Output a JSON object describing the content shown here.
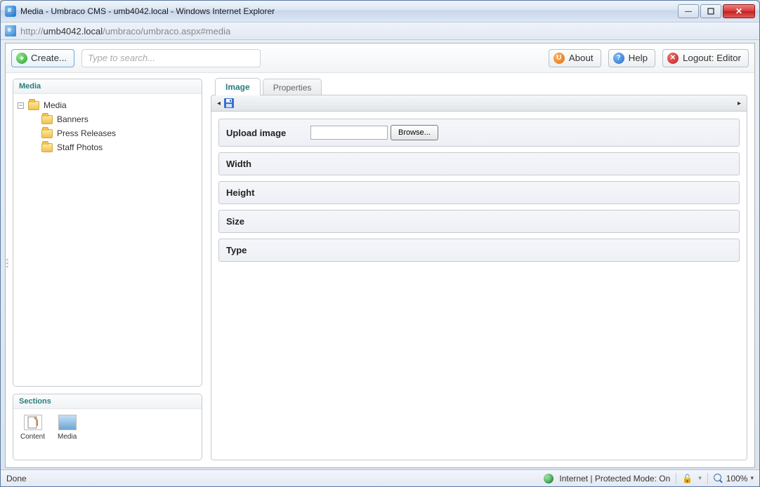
{
  "window": {
    "title": "Media - Umbraco CMS - umb4042.local - Windows Internet Explorer"
  },
  "address": {
    "scheme": "http://",
    "host": "umb4042.local",
    "path": "/umbraco/umbraco.aspx#media"
  },
  "toolbar": {
    "create_label": "Create...",
    "search_placeholder": "Type to search...",
    "about_label": "About",
    "help_label": "Help",
    "logout_label": "Logout: Editor"
  },
  "left": {
    "media_panel_title": "Media",
    "tree": {
      "root": "Media",
      "children": [
        "Banners",
        "Press Releases",
        "Staff Photos"
      ]
    },
    "sections_title": "Sections",
    "sections": {
      "content": "Content",
      "media": "Media"
    }
  },
  "editor": {
    "tabs": {
      "image": "Image",
      "properties": "Properties",
      "active": "image"
    },
    "fields": {
      "upload": {
        "label": "Upload image",
        "browse": "Browse..."
      },
      "width": {
        "label": "Width"
      },
      "height": {
        "label": "Height"
      },
      "size": {
        "label": "Size"
      },
      "type": {
        "label": "Type"
      }
    }
  },
  "status": {
    "done": "Done",
    "zone": "Internet | Protected Mode: On",
    "zoom": "100%"
  }
}
